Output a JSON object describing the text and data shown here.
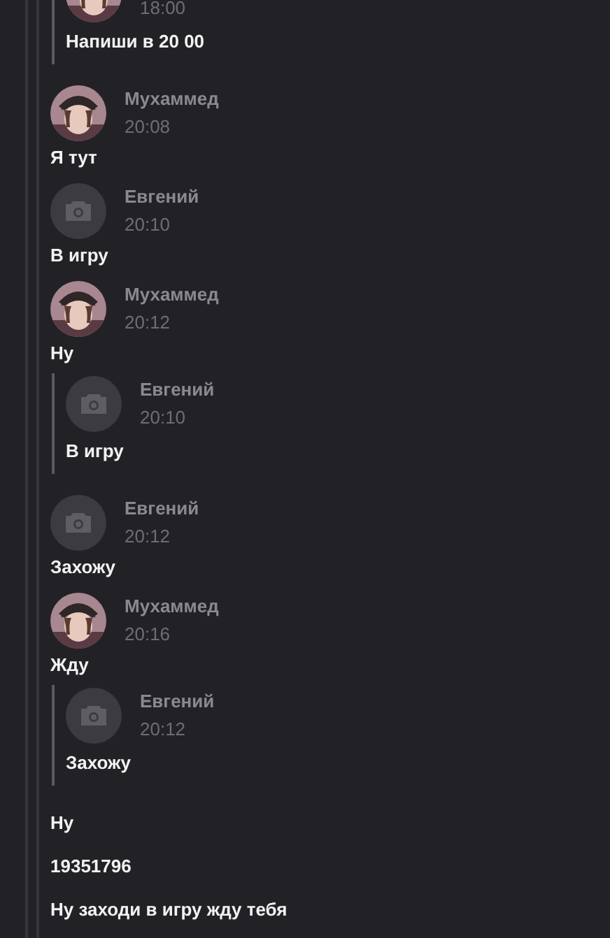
{
  "messages": [
    {
      "kind": "quote_fragment",
      "avatar": {
        "kind": "photo"
      },
      "time": "18:00",
      "text": "Напиши в 20 00"
    },
    {
      "kind": "message",
      "avatar": {
        "kind": "photo"
      },
      "name": "Мухаммед",
      "time": "20:08",
      "text": "Я тут"
    },
    {
      "kind": "message",
      "avatar": {
        "kind": "camera"
      },
      "name": "Евгений",
      "time": "20:10",
      "text": "В игру"
    },
    {
      "kind": "message",
      "avatar": {
        "kind": "photo"
      },
      "name": "Мухаммед",
      "time": "20:12",
      "text": "Ну",
      "quote": {
        "avatar": {
          "kind": "camera"
        },
        "name": "Евгений",
        "time": "20:10",
        "text": "В игру"
      }
    },
    {
      "kind": "message",
      "avatar": {
        "kind": "camera"
      },
      "name": "Евгений",
      "time": "20:12",
      "text": "Захожу"
    },
    {
      "kind": "message",
      "avatar": {
        "kind": "photo"
      },
      "name": "Мухаммед",
      "time": "20:16",
      "text": "Жду",
      "quote": {
        "avatar": {
          "kind": "camera"
        },
        "name": "Евгений",
        "time": "20:12",
        "text": "Захожу"
      }
    },
    {
      "kind": "text",
      "text": "Ну"
    },
    {
      "kind": "text",
      "text": "19351796"
    },
    {
      "kind": "text",
      "text": "Ну заходи в игру жду тебя"
    }
  ]
}
